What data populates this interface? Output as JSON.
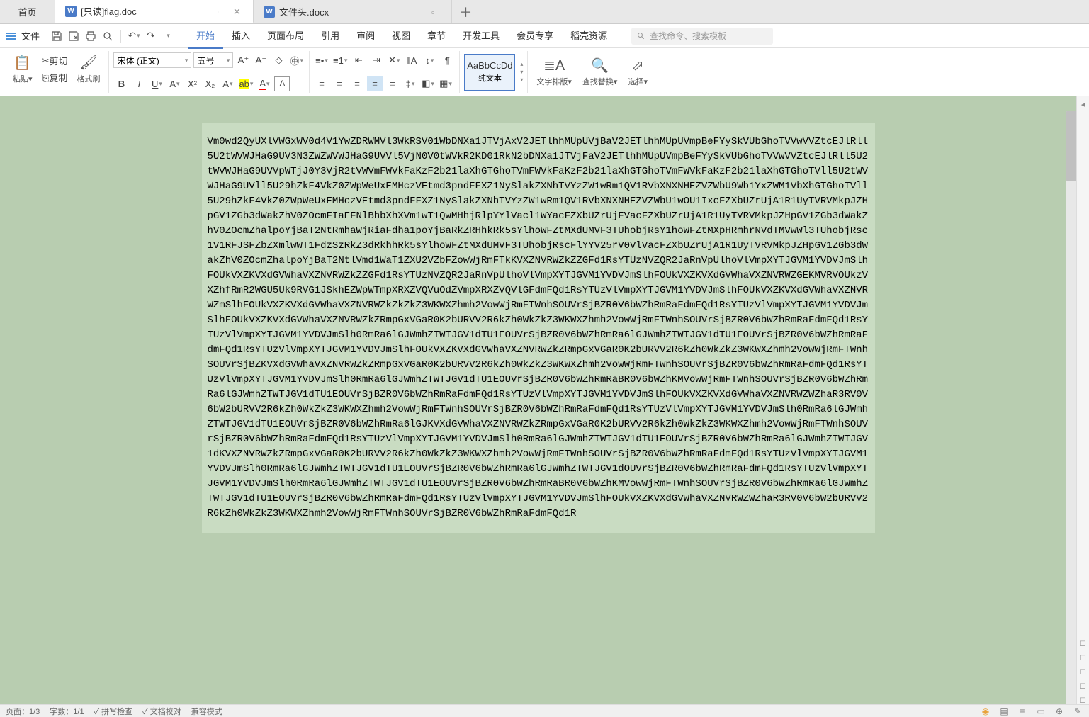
{
  "tabs": {
    "home": "首页",
    "doc1": "[只读]flag.doc",
    "doc2": "文件头.docx"
  },
  "menu": {
    "file": "文件",
    "ribbon": [
      "开始",
      "插入",
      "页面布局",
      "引用",
      "审阅",
      "视图",
      "章节",
      "开发工具",
      "会员专享",
      "稻壳资源"
    ],
    "search_ph": "查找命令、搜索模板"
  },
  "toolbar": {
    "paste": "粘贴",
    "cut": "剪切",
    "copy": "复制",
    "format_painter": "格式刷",
    "font_name": "宋体 (正文)",
    "font_size": "五号",
    "style_sample": "AaBbCcDd",
    "style_name": "纯文本",
    "text_layout": "文字排版",
    "find_replace": "查找替换",
    "select": "选择"
  },
  "document": {
    "body": "Vm0wd2QyUXlVWGxWV0d4V1YwZDRWMVl3WkRSV01WbDNXa1JTVjAxV2JETlhhMUpUVjBaV2JETlhhMUpUVmpBeFYySkVUbGhoTVVwVVZtcEJlRll5U2tWVWJHaG9UV3N3ZWZWVWJHaG9UVVl5VjN0V0tWVkR2KD01RkN2bDNXa1JTVjFaV2JETlhhMUpUVmpBeFYySkVUbGhoTVVwVVZtcEJlRll5U2tWVWJHaG9UVVpWTjJ0Y3VjR2tVWVmFWVkFaKzF2b21laXhGTGhoTVmFWVkFaKzF2b21laXhGTGhoTVmFWVkFaKzF2b21laXhGTGhoTVll5U2tWVWJHaG9UVll5U29hZkF4VkZ0ZWpWeUxEMHczVEtmd3pndFFXZ1NySlakZXNhTVYzZW1wRm1QV1RVbXNXNHEZVZWbU9Wb1YxZWM1VbXhGTGhoTVll5U29hZkF4VkZ0ZWpWeUxEMHczVEtmd3pndFFXZ1NySlakZXNhTVYzZW1wRm1QV1RVbXNXNHEZVZWbU1wOU1IxcFZXbUZrUjA1R1UyTVRVMkpJZHpGV1ZGb3dWakZhV0ZOcmFIaEFNlBhbXhXVm1wT1QwMHhjRlpYYlVacl1WYacFZXbUZrUjFVacFZXbUZrUjA1R1UyTVRVMkpJZHpGV1ZGb3dWakZhV0ZOcmZhalpoYjBaT2NtRmhaWjRiaFdha1poYjBaRkZRHhkRk5sYlhoWFZtMXdUMVF3TUhobjRsY1hoWFZtMXpHRmhrNVdTMVwWl3TUhobjRsc1V1RFJSFZbZXmlwWT1FdzSzRkZ3dRkhhRk5sYlhoWFZtMXdUMVF3TUhobjRscFlYYV25rV0VlVacFZXbUZrUjA1R1UyTVRVMkpJZHpGV1ZGb3dWakZhV0ZOcmZhalpoYjBaT2NtlVmd1WaT1ZXU2VZbFZowWjRmFTkKVXZNVRWZkZZGFd1RsYTUzNVZQR2JaRnVpUlhoVlVmpXYTJGVM1YVDVJmSlhFOUkVXZKVXdGVWhaVXZNVRWZkZZGFd1RsYTUzNVZQR2JaRnVpUlhoVlVmpXYTJGVM1YVDVJmSlhFOUkVXZKVXdGVWhaVXZNVRWZGEKMVRVOUkzVXZhfRmR2WGU5Uk9RVG1JSkhEZWpWTmpXRXZVQVuOdZVmpXRXZVQVlGFdmFQd1RsYTUzVlVmpXYTJGVM1YVDVJmSlhFOUkVXZKVXdGVWhaVXZNVRWZmSlhFOUkVXZKVXdGVWhaVXZNVRWZkZkZkZ3WKWXZhmh2VowWjRmFTWnhSOUVrSjBZR0V6bWZhRmRaFdmFQd1RsYTUzVlVmpXYTJGVM1YVDVJmSlhFOUkVXZKVXdGVWhaVXZNVRWZkZRmpGxVGaR0K2bURVV2R6kZh0WkZkZ3WKWXZhmh2VowWjRmFTWnhSOUVrSjBZR0V6bWZhRmRaFdmFQd1RsYTUzVlVmpXYTJGVM1YVDVJmSlh0RmRa6lGJWmhZTWTJGV1dTU1EOUVrSjBZR0V6bWZhRmRa6lGJWmhZTWTJGV1dTU1EOUVrSjBZR0V6bWZhRmRaFdmFQd1RsYTUzVlVmpXYTJGVM1YVDVJmSlhFOUkVXZKVXdGVWhaVXZNVRWZkZRmpGxVGaR0K2bURVV2R6kZh0WkZkZ3WKWXZhmh2VowWjRmFTWnhSOUVrSjBZKVXdGVWhaVXZNVRWZkZRmpGxVGaR0K2bURVV2R6kZh0WkZkZ3WKWXZhmh2VowWjRmFTWnhSOUVrSjBZR0V6bWZhRmRaFdmFQd1RsYTUzVlVmpXYTJGVM1YVDVJmSlh0RmRa6lGJWmhZTWTJGV1dTU1EOUVrSjBZR0V6bWZhRmRaBR0V6bWZhKMVowWjRmFTWnhSOUVrSjBZR0V6bWZhRmRa6lGJWmhZTWTJGV1dTU1EOUVrSjBZR0V6bWZhRmRaFdmFQd1RsYTUzVlVmpXYTJGVM1YVDVJmSlhFOUkVXZKVXdGVWhaVXZNVRWZWZhaR3RV0V6bW2bURVV2R6kZh0WkZkZ3WKWXZhmh2VowWjRmFTWnhSOUVrSjBZR0V6bWZhRmRaFdmFQd1RsYTUzVlVmpXYTJGVM1YVDVJmSlh0RmRa6lGJWmhZTWTJGV1dTU1EOUVrSjBZR0V6bWZhRmRa6lGJKVXdGVWhaVXZNVRWZkZRmpGxVGaR0K2bURVV2R6kZh0WkZkZ3WKWXZhmh2VowWjRmFTWnhSOUVrSjBZR0V6bWZhRmRaFdmFQd1RsYTUzVlVmpXYTJGVM1YVDVJmSlh0RmRa6lGJWmhZTWTJGV1dTU1EOUVrSjBZR0V6bWZhRmRa6lGJWmhZTWTJGV1dKVXZNVRWZkZRmpGxVGaR0K2bURVV2R6kZh0WkZkZ3WKWXZhmh2VowWjRmFTWnhSOUVrSjBZR0V6bWZhRmRaFdmFQd1RsYTUzVlVmpXYTJGVM1YVDVJmSlh0RmRa6lGJWmhZTWTJGV1dTU1EOUVrSjBZR0V6bWZhRmRa6lGJWmhZTWTJGV1dOUVrSjBZR0V6bWZhRmRaFdmFQd1RsYTUzVlVmpXYTJGVM1YVDVJmSlh0RmRa6lGJWmhZTWTJGV1dTU1EOUVrSjBZR0V6bWZhRmRaBR0V6bWZhKMVowWjRmFTWnhSOUVrSjBZR0V6bWZhRmRa6lGJWmhZTWTJGV1dTU1EOUVrSjBZR0V6bWZhRmRaFdmFQd1RsYTUzVlVmpXYTJGVM1YVDVJmSlhFOUkVXZKVXdGVWhaVXZNVRWZWZhaR3RV0V6bW2bURVV2R6kZh0WkZkZ3WKWXZhmh2VowWjRmFTWnhSOUVrSjBZR0V6bWZhRmRaFdmFQd1R"
  },
  "status": {
    "page": "页面：1/3",
    "words": "字数：1/1",
    "spell": "拼写检查",
    "doc_check": "文档校对",
    "compat": "兼容模式"
  }
}
